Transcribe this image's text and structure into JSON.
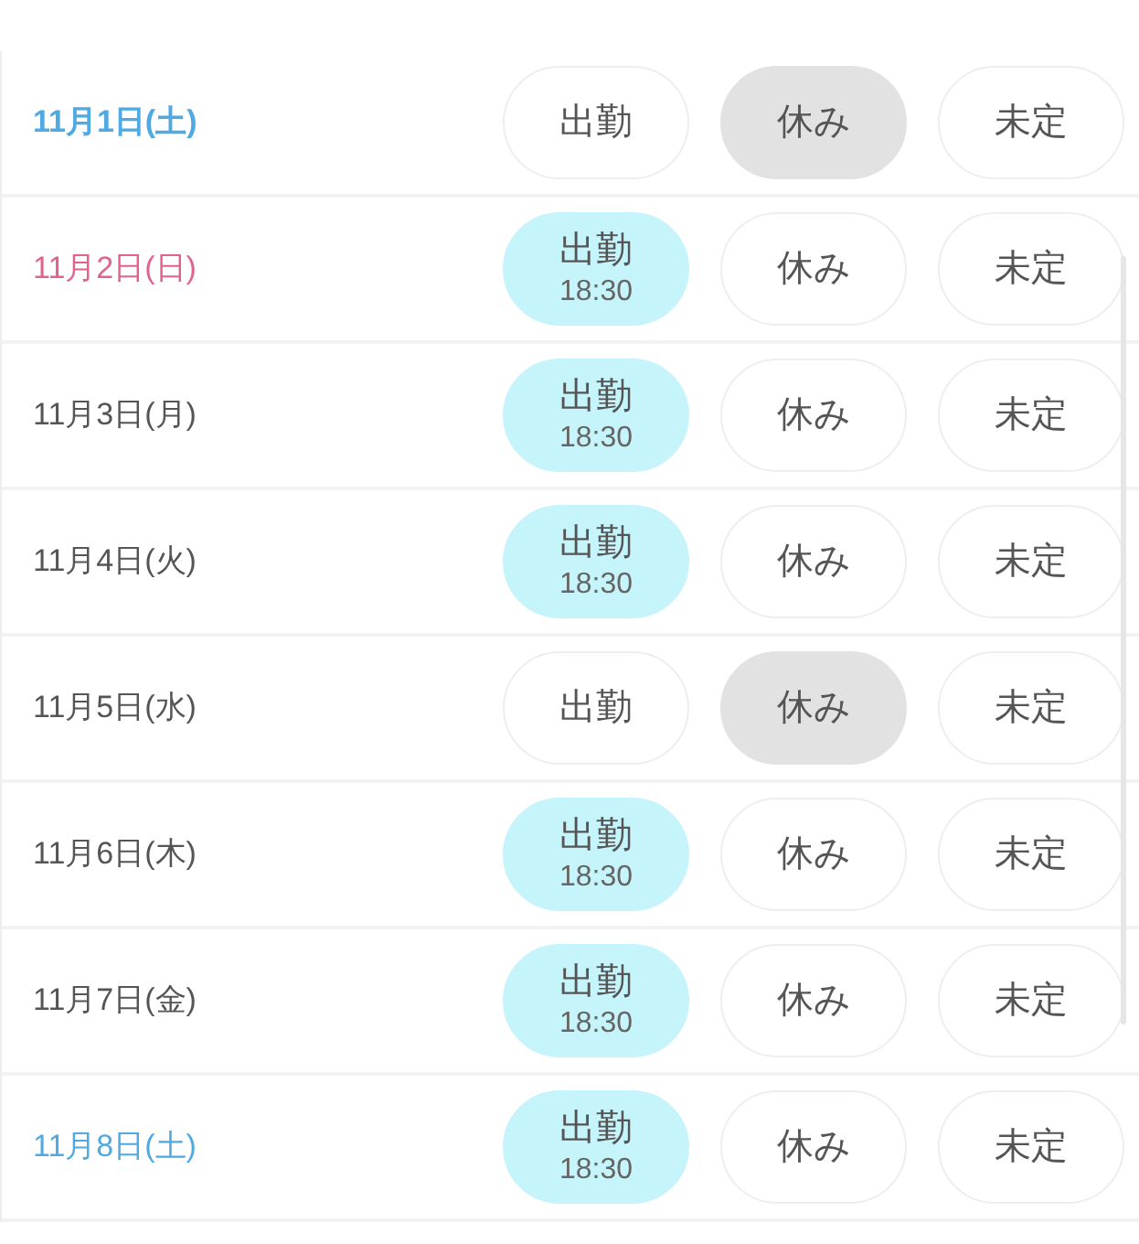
{
  "days": [
    {
      "date": "11月1日(土)",
      "color": "#4fa9e3",
      "today": true,
      "options": [
        {
          "kind": "work",
          "label": "出勤",
          "selected": false
        },
        {
          "kind": "off",
          "label": "休み",
          "selected": true
        },
        {
          "kind": "undecided",
          "label": "未定",
          "selected": false
        }
      ]
    },
    {
      "date": "11月2日(日)",
      "color": "#e2628f",
      "today": false,
      "options": [
        {
          "kind": "work",
          "label": "出勤",
          "time": "18:30",
          "selected": true
        },
        {
          "kind": "off",
          "label": "休み",
          "selected": false
        },
        {
          "kind": "undecided",
          "label": "未定",
          "selected": false
        }
      ]
    },
    {
      "date": "11月3日(月)",
      "color": "#555555",
      "today": false,
      "options": [
        {
          "kind": "work",
          "label": "出勤",
          "time": "18:30",
          "selected": true
        },
        {
          "kind": "off",
          "label": "休み",
          "selected": false
        },
        {
          "kind": "undecided",
          "label": "未定",
          "selected": false
        }
      ]
    },
    {
      "date": "11月4日(火)",
      "color": "#555555",
      "today": false,
      "options": [
        {
          "kind": "work",
          "label": "出勤",
          "time": "18:30",
          "selected": true
        },
        {
          "kind": "off",
          "label": "休み",
          "selected": false
        },
        {
          "kind": "undecided",
          "label": "未定",
          "selected": false
        }
      ]
    },
    {
      "date": "11月5日(水)",
      "color": "#555555",
      "today": false,
      "options": [
        {
          "kind": "work",
          "label": "出勤",
          "selected": false
        },
        {
          "kind": "off",
          "label": "休み",
          "selected": true
        },
        {
          "kind": "undecided",
          "label": "未定",
          "selected": false
        }
      ]
    },
    {
      "date": "11月6日(木)",
      "color": "#555555",
      "today": false,
      "options": [
        {
          "kind": "work",
          "label": "出勤",
          "time": "18:30",
          "selected": true
        },
        {
          "kind": "off",
          "label": "休み",
          "selected": false
        },
        {
          "kind": "undecided",
          "label": "未定",
          "selected": false
        }
      ]
    },
    {
      "date": "11月7日(金)",
      "color": "#555555",
      "today": false,
      "options": [
        {
          "kind": "work",
          "label": "出勤",
          "time": "18:30",
          "selected": true
        },
        {
          "kind": "off",
          "label": "休み",
          "selected": false
        },
        {
          "kind": "undecided",
          "label": "未定",
          "selected": false
        }
      ]
    },
    {
      "date": "11月8日(土)",
      "color": "#4fa9e3",
      "today": false,
      "options": [
        {
          "kind": "work",
          "label": "出勤",
          "time": "18:30",
          "selected": true
        },
        {
          "kind": "off",
          "label": "休み",
          "selected": false
        },
        {
          "kind": "undecided",
          "label": "未定",
          "selected": false
        }
      ]
    }
  ]
}
